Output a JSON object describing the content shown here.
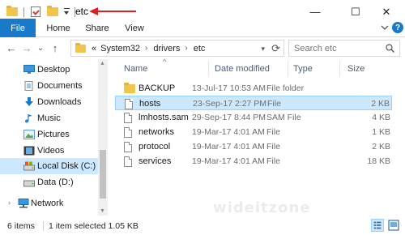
{
  "window": {
    "title": "etc",
    "controls": {
      "minimize": "—",
      "maximize": "☐",
      "close": "✕"
    }
  },
  "ribbon": {
    "tabs": [
      {
        "label": "File",
        "active": true
      },
      {
        "label": "Home"
      },
      {
        "label": "Share"
      },
      {
        "label": "View"
      }
    ],
    "help_label": "?"
  },
  "nav": {
    "back": "←",
    "forward": "→",
    "recent": "⌄",
    "up": "↑",
    "path_prefix": "«",
    "breadcrumbs": [
      "System32",
      "drivers",
      "etc"
    ],
    "crumb_separator": "›",
    "refresh": "⟳",
    "search_placeholder": "Search etc"
  },
  "sidebar": {
    "items": [
      {
        "label": "Desktop",
        "icon": "desktop-icon"
      },
      {
        "label": "Documents",
        "icon": "documents-icon"
      },
      {
        "label": "Downloads",
        "icon": "downloads-icon"
      },
      {
        "label": "Music",
        "icon": "music-icon"
      },
      {
        "label": "Pictures",
        "icon": "pictures-icon"
      },
      {
        "label": "Videos",
        "icon": "videos-icon"
      },
      {
        "label": "Local Disk (C:)",
        "icon": "drive-icon",
        "selected": true
      },
      {
        "label": "Data (D:)",
        "icon": "drive-icon"
      },
      {
        "label": "Network",
        "icon": "network-icon",
        "expander": "›"
      }
    ]
  },
  "filelist": {
    "columns": {
      "name": "Name",
      "date": "Date modified",
      "type": "Type",
      "size": "Size"
    },
    "sort_indicator": "^",
    "rows": [
      {
        "name": "BACKUP",
        "date": "13-Jul-17 10:53 AM",
        "type": "File folder",
        "size": "",
        "kind": "folder"
      },
      {
        "name": "hosts",
        "date": "23-Sep-17 2:27 PM",
        "type": "File",
        "size": "2 KB",
        "kind": "file",
        "selected": true
      },
      {
        "name": "lmhosts.sam",
        "date": "29-Sep-17 8:44 PM",
        "type": "SAM File",
        "size": "4 KB",
        "kind": "file"
      },
      {
        "name": "networks",
        "date": "19-Mar-17 4:01 AM",
        "type": "File",
        "size": "1 KB",
        "kind": "file"
      },
      {
        "name": "protocol",
        "date": "19-Mar-17 4:01 AM",
        "type": "File",
        "size": "2 KB",
        "kind": "file"
      },
      {
        "name": "services",
        "date": "19-Mar-17 4:01 AM",
        "type": "File",
        "size": "18 KB",
        "kind": "file"
      }
    ]
  },
  "watermark": "wideitzone",
  "status": {
    "item_count": "6 items",
    "selection": "1 item selected  1.05 KB"
  },
  "colors": {
    "accent": "#1979ca",
    "selection_bg": "#cce8ff",
    "selection_border": "#99d1ff",
    "folder": "#f0c54a",
    "annotation_arrow": "#e02020"
  }
}
